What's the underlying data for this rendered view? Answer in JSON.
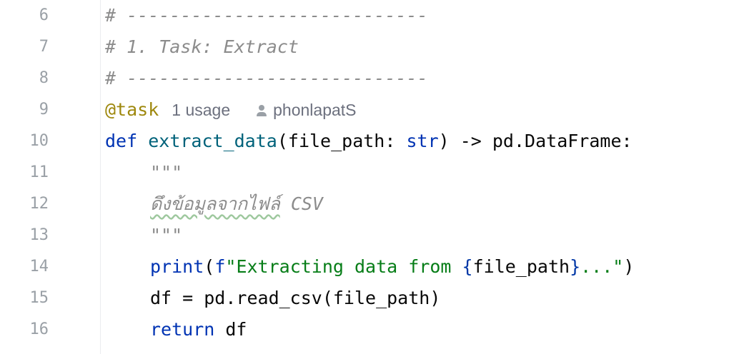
{
  "lines": [
    {
      "num": "6",
      "text": "# ----------------------------"
    },
    {
      "num": "7",
      "text": "# 1. Task: Extract"
    },
    {
      "num": "8",
      "text": "# ----------------------------"
    },
    {
      "num": "9",
      "decorator": "@task",
      "usages": "1 usage",
      "author": "phonlapatS"
    },
    {
      "num": "10",
      "kw": "def",
      "fname": "extract_data",
      "params": "(file_path: ",
      "type": "str",
      "ret": ") -> pd.DataFrame:"
    },
    {
      "num": "11",
      "text": "\"\"\""
    },
    {
      "num": "12",
      "thai": "ดึงข้อมูลจากไฟล์",
      "rest": " CSV"
    },
    {
      "num": "13",
      "text": "\"\"\""
    },
    {
      "num": "14",
      "fn": "print",
      "open": "(",
      "fprefix": "f",
      "str_a": "\"Extracting data from ",
      "lb": "{",
      "var": "file_path",
      "rb": "}",
      "str_b": "...\"",
      "close": ")"
    },
    {
      "num": "15",
      "text": "df = pd.read_csv(file_path)"
    },
    {
      "num": "16",
      "kw": "return",
      "rest": " df"
    }
  ]
}
